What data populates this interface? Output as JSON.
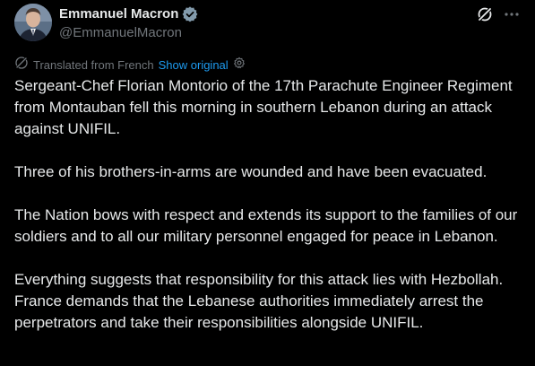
{
  "author": {
    "display_name": "Emmanuel Macron",
    "handle": "@EmmanuelMacron",
    "verified_color": "#829aab"
  },
  "actions": {
    "grok_icon": "grok-icon",
    "more_icon": "more-icon"
  },
  "translation": {
    "label": "Translated from French",
    "show_original": "Show original"
  },
  "body": {
    "paragraphs": [
      "Sergeant-Chef Florian Montorio of the 17th Parachute Engineer Regiment from Montauban fell this morning in southern Lebanon during an attack against UNIFIL.",
      "Three of his brothers-in-arms are wounded and have been evacuated.",
      "The Nation bows with respect and extends its support to the families of our soldiers and to all our military personnel engaged for peace in Lebanon.",
      "Everything suggests that responsibility for this attack lies with Hezbollah. France demands that the Lebanese authorities immediately arrest the perpetrators and take their responsibilities alongside UNIFIL."
    ]
  },
  "colors": {
    "background": "#000000",
    "text": "#e7e9ea",
    "muted": "#71767b",
    "link": "#1d9bf0"
  }
}
